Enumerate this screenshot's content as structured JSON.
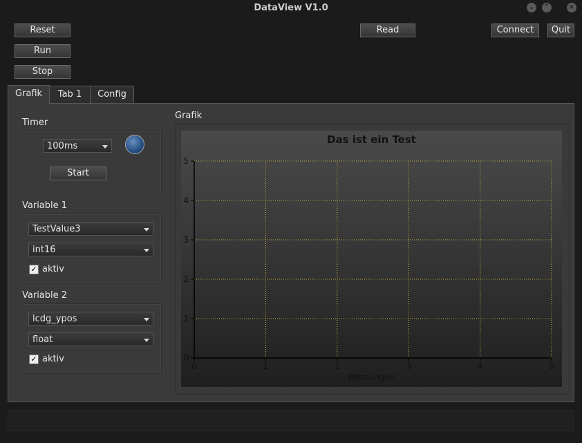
{
  "window": {
    "title": "DataView V1.0",
    "minimize_glyph": "⌄",
    "maximize_glyph": "⌃",
    "close_glyph": "×"
  },
  "toolbar": {
    "reset": "Reset",
    "run": "Run",
    "stop": "Stop",
    "read": "Read",
    "connect": "Connect",
    "quit": "Quit"
  },
  "tabs": [
    {
      "label": "Grafik"
    },
    {
      "label": "Tab 1"
    },
    {
      "label": "Config"
    }
  ],
  "timer": {
    "label": "Timer",
    "interval": "100ms",
    "start": "Start"
  },
  "variable1": {
    "label": "Variable 1",
    "name": "TestValue3",
    "type": "int16",
    "active_label": "aktiv",
    "active": true,
    "check_glyph": "✓"
  },
  "variable2": {
    "label": "Variable 2",
    "name": "lcdg_ypos",
    "type": "float",
    "active_label": "aktiv",
    "active": true,
    "check_glyph": "✓"
  },
  "grafik": {
    "label": "Grafik"
  },
  "colors": {
    "led": "#2a5488",
    "grid": "#c8b23c",
    "plot_bg_top": "#4a4a4a",
    "plot_bg_bottom": "#1f1f1f"
  },
  "chart_data": {
    "type": "line",
    "title": "Das ist ein Test",
    "xlabel": "Messungen",
    "ylabel": "",
    "xlim": [
      0,
      5
    ],
    "ylim": [
      0,
      5
    ],
    "x_ticks": [
      "0",
      "1",
      "2",
      "3",
      "4",
      "5"
    ],
    "y_ticks": [
      "0",
      "1",
      "2",
      "3",
      "4",
      "5"
    ],
    "grid": true,
    "series": []
  }
}
